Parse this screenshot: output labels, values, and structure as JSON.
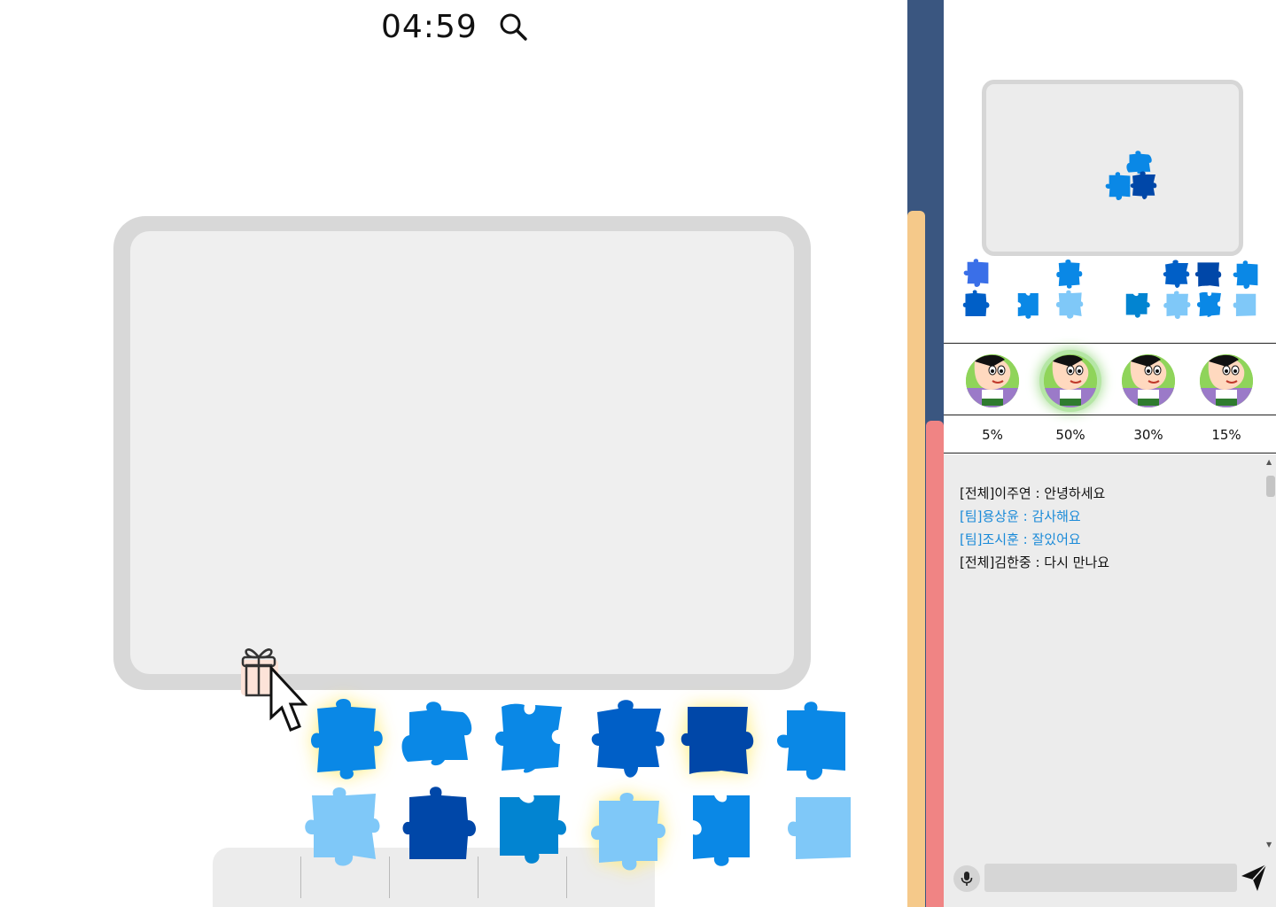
{
  "timer": {
    "time": "04:59",
    "search_icon": "search-icon"
  },
  "colors": {
    "piece_mid": "#0a88e6",
    "piece_dark": "#0047a8",
    "piece_royal": "#005fc7",
    "piece_light": "#7fc8f8",
    "piece_teal": "#0284d1",
    "glow": "#fff39a",
    "board_frame": "#d8d8d8",
    "board_inner": "#efefef",
    "stripe_blue": "#3a5680",
    "stripe_yellow": "#f5c98a",
    "stripe_red": "#f08484",
    "team_chat": "#1a8ad8"
  },
  "players": [
    {
      "progress": "5%",
      "active": false
    },
    {
      "progress": "50%",
      "active": true
    },
    {
      "progress": "30%",
      "active": false
    },
    {
      "progress": "15%",
      "active": false
    }
  ],
  "chat": {
    "messages": [
      {
        "text": "[전체]이주연 : 안녕하세요",
        "channel": "all"
      },
      {
        "text": "[팀]용상윤 : 감사해요",
        "channel": "team"
      },
      {
        "text": "[팀]조시훈 : 잘있어요",
        "channel": "team"
      },
      {
        "text": "[전체]김한중 : 다시 만나요",
        "channel": "all"
      }
    ],
    "input_placeholder": ""
  },
  "icons": {
    "gift": "gift-icon",
    "cursor": "cursor-icon",
    "mic": "mic-icon",
    "send": "send-icon"
  }
}
